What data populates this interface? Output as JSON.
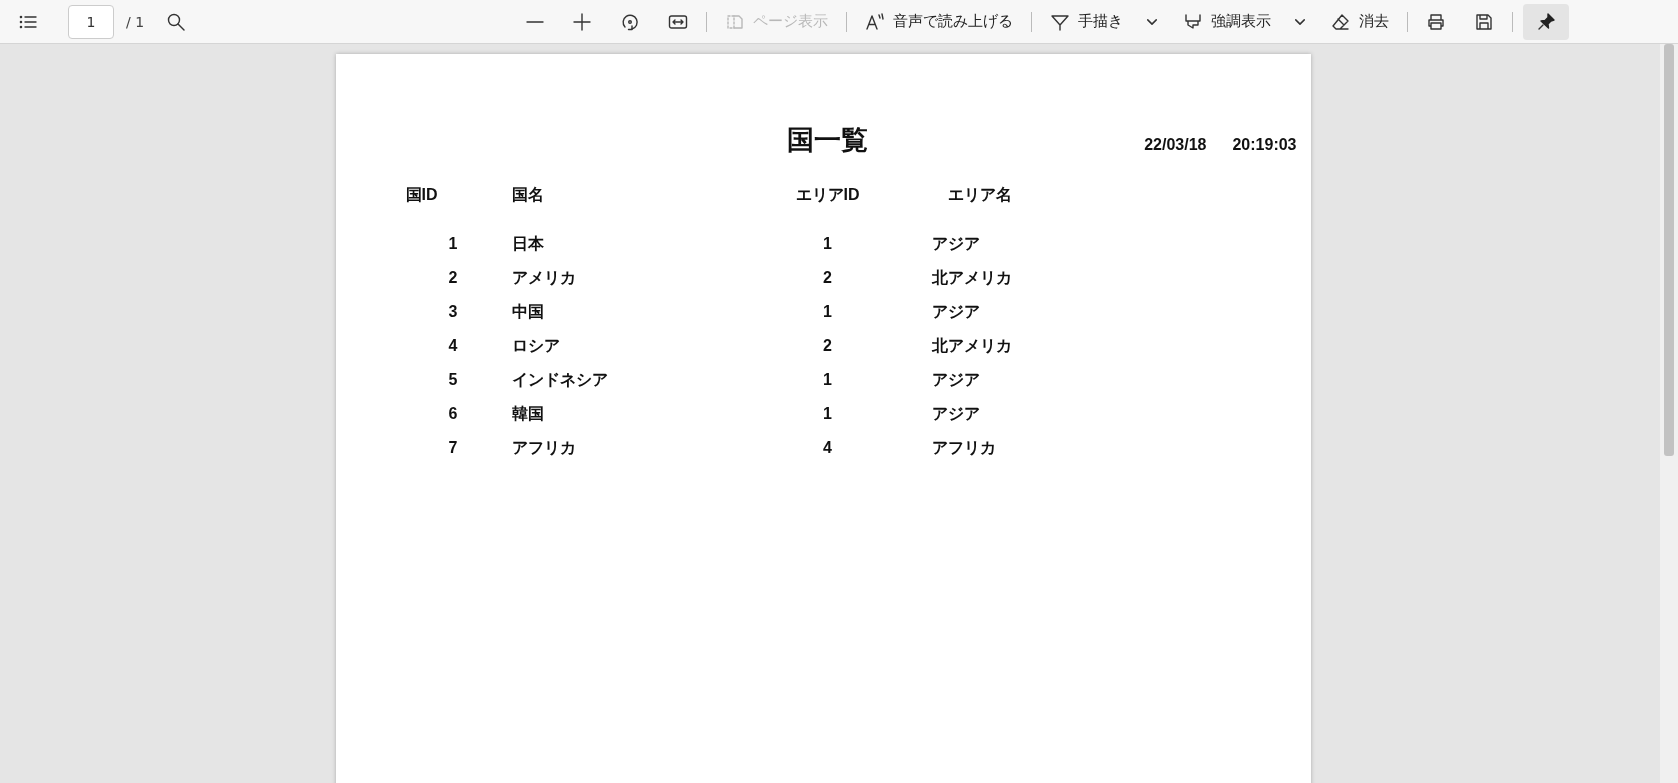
{
  "toolbar": {
    "page_number": "1",
    "page_count": "/ 1",
    "page_view": {
      "label": "ページ表示",
      "disabled": true
    },
    "read_aloud": {
      "label": "音声で読み上げる"
    },
    "draw": {
      "label": "手描き"
    },
    "highlight": {
      "label": "強調表示"
    },
    "erase": {
      "label": "消去"
    },
    "pin": {
      "selected": true
    }
  },
  "document": {
    "title": "国一覧",
    "date": "22/03/18",
    "time": "20:19:03",
    "columns": [
      "国ID",
      "国名",
      "エリアID",
      "エリア名"
    ],
    "rows": [
      [
        "1",
        "日本",
        "1",
        "アジア"
      ],
      [
        "2",
        "アメリカ",
        "2",
        "北アメリカ"
      ],
      [
        "3",
        "中国",
        "1",
        "アジア"
      ],
      [
        "4",
        "ロシア",
        "2",
        "北アメリカ"
      ],
      [
        "5",
        "インドネシア",
        "1",
        "アジア"
      ],
      [
        "6",
        "韓国",
        "1",
        "アジア"
      ],
      [
        "7",
        "アフリカ",
        "4",
        "アフリカ"
      ]
    ]
  }
}
